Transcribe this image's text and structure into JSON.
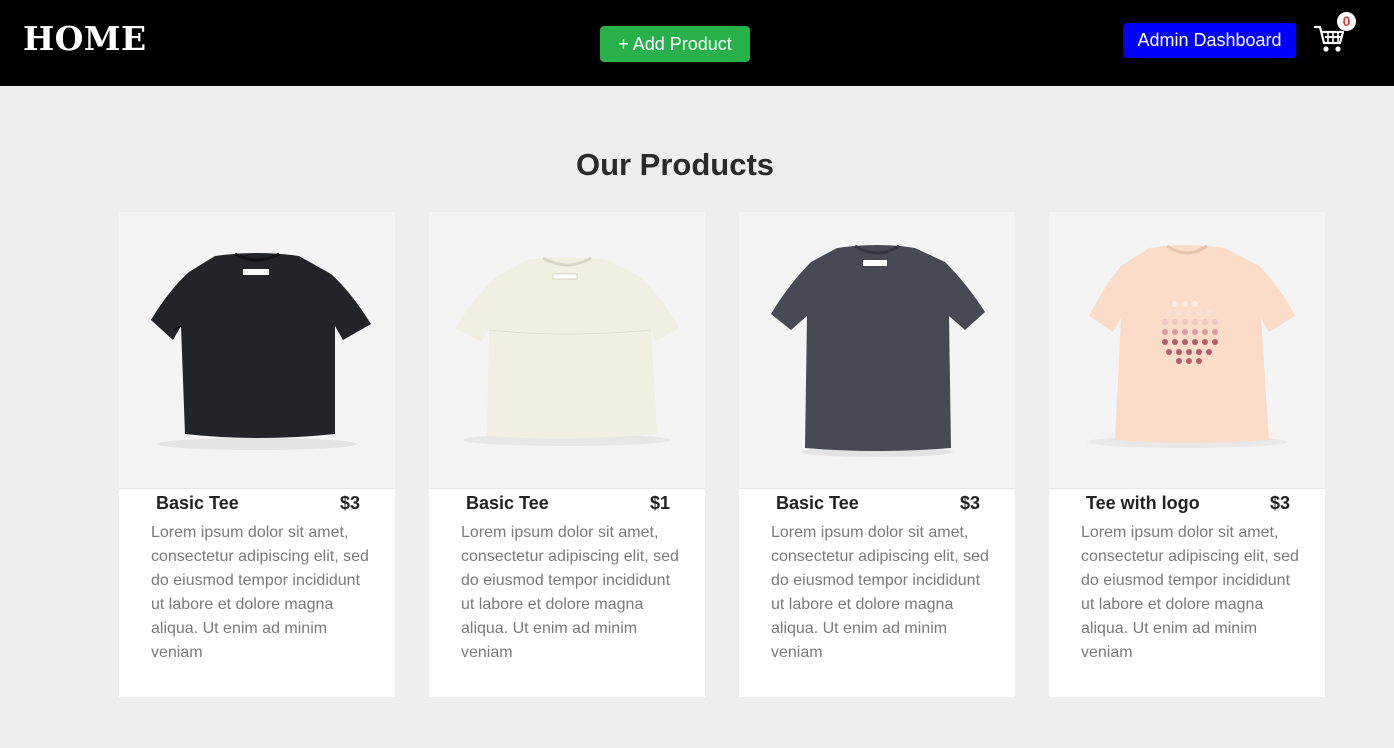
{
  "header": {
    "home_label": "HOME",
    "add_product_label": "+ Add Product",
    "admin_dashboard_label": "Admin Dashboard",
    "cart_count": "0",
    "cart_icon": "shopping-cart-icon",
    "colors": {
      "bar": "#000000",
      "add_button": "#28b04b",
      "admin_button": "#0000ff",
      "badge_text": "#e23b3b"
    }
  },
  "main": {
    "title": "Our Products",
    "products": [
      {
        "name": "Basic Tee",
        "price": "$3",
        "description": "Lorem ipsum dolor sit amet, consectetur adipiscing elit, sed do eiusmod tempor incididunt ut labore et dolore magna aliqua. Ut enim ad minim veniam",
        "image": "black-tshirt-image",
        "shirt_color": "#23232a"
      },
      {
        "name": "Basic Tee",
        "price": "$1",
        "description": "Lorem ipsum dolor sit amet, consectetur adipiscing elit, sed do eiusmod tempor incididunt ut labore et dolore magna aliqua. Ut enim ad minim veniam",
        "image": "off-white-tshirt-image",
        "shirt_color": "#f1eee2"
      },
      {
        "name": "Basic Tee",
        "price": "$3",
        "description": "Lorem ipsum dolor sit amet, consectetur adipiscing elit, sed do eiusmod tempor incididunt ut labore et dolore magna aliqua. Ut enim ad minim veniam",
        "image": "charcoal-tshirt-image",
        "shirt_color": "#474955"
      },
      {
        "name": "Tee with logo",
        "price": "$3",
        "description": "Lorem ipsum dolor sit amet, consectetur adipiscing elit, sed do eiusmod tempor incididunt ut labore et dolore magna aliqua. Ut enim ad minim veniam",
        "image": "peach-logo-tshirt-image",
        "shirt_color": "#fadcc9"
      }
    ]
  }
}
